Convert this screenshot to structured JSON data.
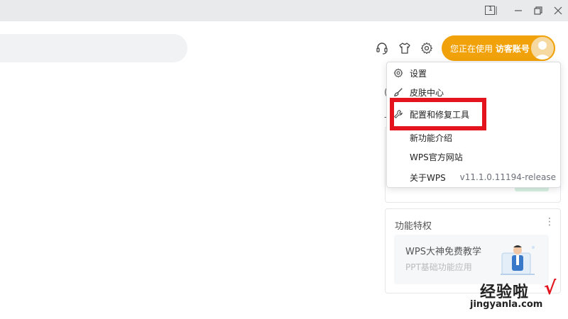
{
  "window": {
    "controls": [
      "tab-count",
      "minimize",
      "restore",
      "close"
    ],
    "tab_count": "1"
  },
  "header": {
    "icons": [
      "headset-icon",
      "tshirt-icon",
      "gear-icon"
    ],
    "account": {
      "prefix": "您正在使用",
      "name": "访客账号"
    }
  },
  "menu": {
    "items": [
      {
        "label": "设置",
        "icon": "gear-icon"
      },
      {
        "label": "皮肤中心",
        "icon": "brush-icon"
      },
      {
        "label": "配置和修复工具",
        "icon": "wrench-icon"
      },
      {
        "label": "新功能介绍",
        "icon": ""
      },
      {
        "label": "WPS官方网站",
        "icon": ""
      },
      {
        "label": "关于WPS",
        "icon": "",
        "version": "v11.1.0.11194-release"
      }
    ],
    "highlighted_item": "配置和修复工具",
    "highlight_color": "#e3141d"
  },
  "cards": {
    "features": {
      "title": "功能特权",
      "more": "⋮",
      "promo_title": "WPS大神免费教学",
      "promo_subtitle": "PPT基础功能应用"
    }
  },
  "watermark": {
    "text": "经验啦",
    "check": "√",
    "url": "jingyanla.com"
  },
  "colors": {
    "accent": "#f1a20a",
    "titlebar": "#e9eaec",
    "highlight": "#e3141d"
  }
}
